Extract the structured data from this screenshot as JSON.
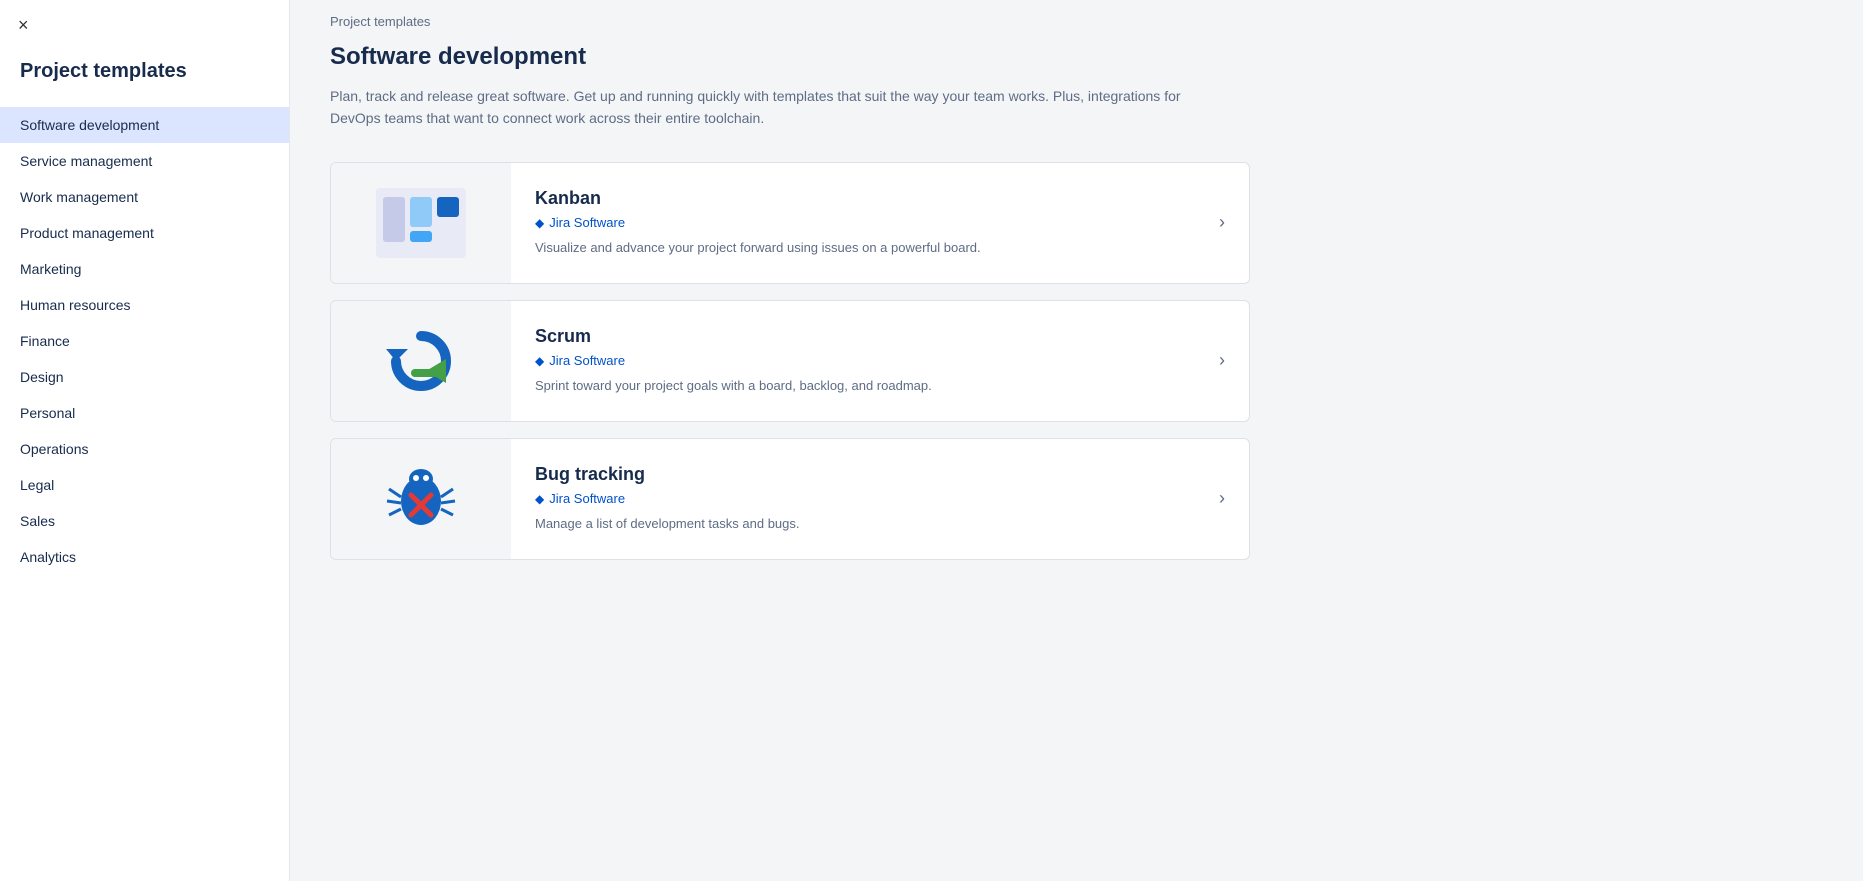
{
  "breadcrumb": "Project templates",
  "sidebar": {
    "title": "Project templates",
    "close_symbol": "×",
    "items": [
      {
        "id": "software-development",
        "label": "Software development",
        "active": true
      },
      {
        "id": "service-management",
        "label": "Service management",
        "active": false
      },
      {
        "id": "work-management",
        "label": "Work management",
        "active": false
      },
      {
        "id": "product-management",
        "label": "Product management",
        "active": false
      },
      {
        "id": "marketing",
        "label": "Marketing",
        "active": false
      },
      {
        "id": "human-resources",
        "label": "Human resources",
        "active": false
      },
      {
        "id": "finance",
        "label": "Finance",
        "active": false
      },
      {
        "id": "design",
        "label": "Design",
        "active": false
      },
      {
        "id": "personal",
        "label": "Personal",
        "active": false
      },
      {
        "id": "operations",
        "label": "Operations",
        "active": false
      },
      {
        "id": "legal",
        "label": "Legal",
        "active": false
      },
      {
        "id": "sales",
        "label": "Sales",
        "active": false
      },
      {
        "id": "analytics",
        "label": "Analytics",
        "active": false
      }
    ]
  },
  "main": {
    "section_title": "Software development",
    "section_desc": "Plan, track and release great software. Get up and running quickly with templates that suit the way your team works. Plus, integrations for DevOps teams that want to connect work across their entire toolchain.",
    "templates": [
      {
        "id": "kanban",
        "title": "Kanban",
        "badge": "Jira Software",
        "desc": "Visualize and advance your project forward using issues on a powerful board.",
        "icon_type": "kanban"
      },
      {
        "id": "scrum",
        "title": "Scrum",
        "badge": "Jira Software",
        "desc": "Sprint toward your project goals with a board, backlog, and roadmap.",
        "icon_type": "scrum"
      },
      {
        "id": "bug-tracking",
        "title": "Bug tracking",
        "badge": "Jira Software",
        "desc": "Manage a list of development tasks and bugs.",
        "icon_type": "bug"
      }
    ]
  },
  "colors": {
    "accent": "#0052cc",
    "sidebar_active_bg": "#dce5ff",
    "text_dark": "#172b4d",
    "text_muted": "#5e6c84"
  }
}
